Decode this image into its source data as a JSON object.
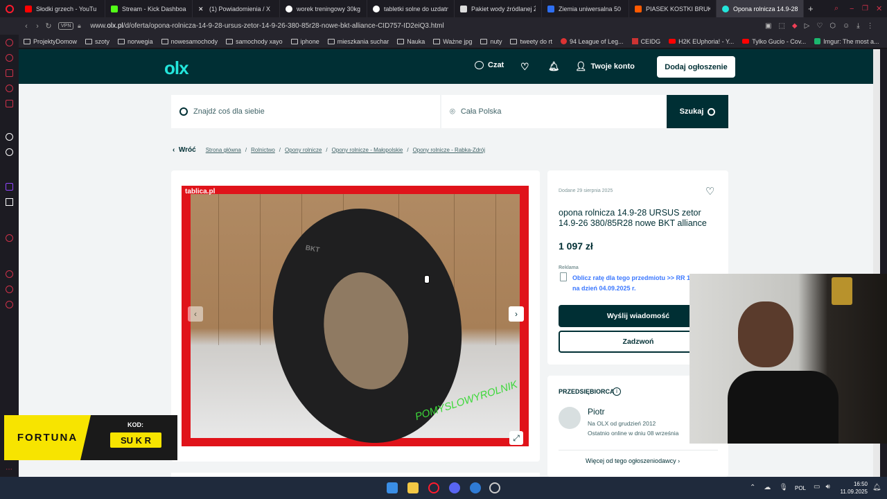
{
  "browser": {
    "tabs": [
      {
        "label": "Słodki grzech - YouTu",
        "color": "#ff0000"
      },
      {
        "label": "Stream - Kick Dashboard",
        "color": "#53fc18"
      },
      {
        "label": "(1) Powiadomienia / X",
        "color": "#ffffff"
      },
      {
        "label": "worek treningowy 30kg",
        "color": "#4285f4"
      },
      {
        "label": "tabletki solne do uzdatni",
        "color": "#4285f4"
      },
      {
        "label": "Pakiet wody źródlanej Ż",
        "color": "#dddddd"
      },
      {
        "label": "Ziemia uniwersalna 50 l",
        "color": "#2e6ff2"
      },
      {
        "label": "PIASEK KOSTKI BRUKOW",
        "color": "#ff5a00"
      },
      {
        "label": "Opona rolnicza 14.9-28 U",
        "color": "#23e5db"
      }
    ],
    "vpn_label": "VPN",
    "url_prefix": "www.",
    "url_host": "olx.pl",
    "url_path": "/d/oferta/opona-rolnicza-14-9-28-ursus-zetor-14-9-26-380-85r28-nowe-bkt-alliance-CID757-ID2eiQ3.html",
    "bookmarks": [
      "ProjektyDomow",
      "szoty",
      "norwegia",
      "nowesamochody",
      "samochody xayo",
      "iphone",
      "mieszkania suchar",
      "Nauka",
      "Ważne jpg",
      "nuty",
      "tweety do rt",
      "94 League of Leg...",
      "CEIDG",
      "H2K EUphoria! - Y...",
      "Tylko Gucio - Cov...",
      "Imgur: The most a..."
    ]
  },
  "olx": {
    "logo": "olx",
    "chat": "Czat",
    "account": "Twoje konto",
    "add_listing": "Dodaj ogłoszenie",
    "search_placeholder": "Znajdź coś dla siebie",
    "location": "Cała Polska",
    "search_button": "Szukaj",
    "back": "Wróć",
    "breadcrumbs": [
      "Strona główna",
      "Rolnictwo",
      "Opony rolnicze",
      "Opony rolnicze - Małopolskie",
      "Opony rolnicze - Rabka-Zdrój"
    ],
    "photo_watermark": "tablica.pl",
    "photo_brand": "BKT",
    "photo_caption": "POMYSLOWYROLNIK",
    "added": "Dodane 29 sierpnia 2025",
    "title": "opona rolnicza 14.9-28 URSUS zetor 14.9-26 380/85R28 nowe BKT alliance",
    "price": "1 097 zł",
    "ad_label": "Reklama",
    "ad_text": "Oblicz ratę dla tego przedmiotu >> RR 11,57% na dzień 04.09.2025 r.",
    "send_message": "Wyślij wiadomość",
    "call": "Zadzwoń",
    "seller_type": "PRZEDSIĘBIORCA",
    "seller_name": "Piotr",
    "seller_since": "Na OLX od grudzień 2012",
    "seller_online": "Ostatnio online w dniu 08 września",
    "more_ads": "Więcej od tego ogłoszeniodawcy"
  },
  "overlay": {
    "brand": "FORTUNA",
    "code_label": "KOD:",
    "code": "SU K R"
  },
  "taskbar": {
    "language": "POL",
    "time": "16:50",
    "date": "11.09.2025"
  }
}
